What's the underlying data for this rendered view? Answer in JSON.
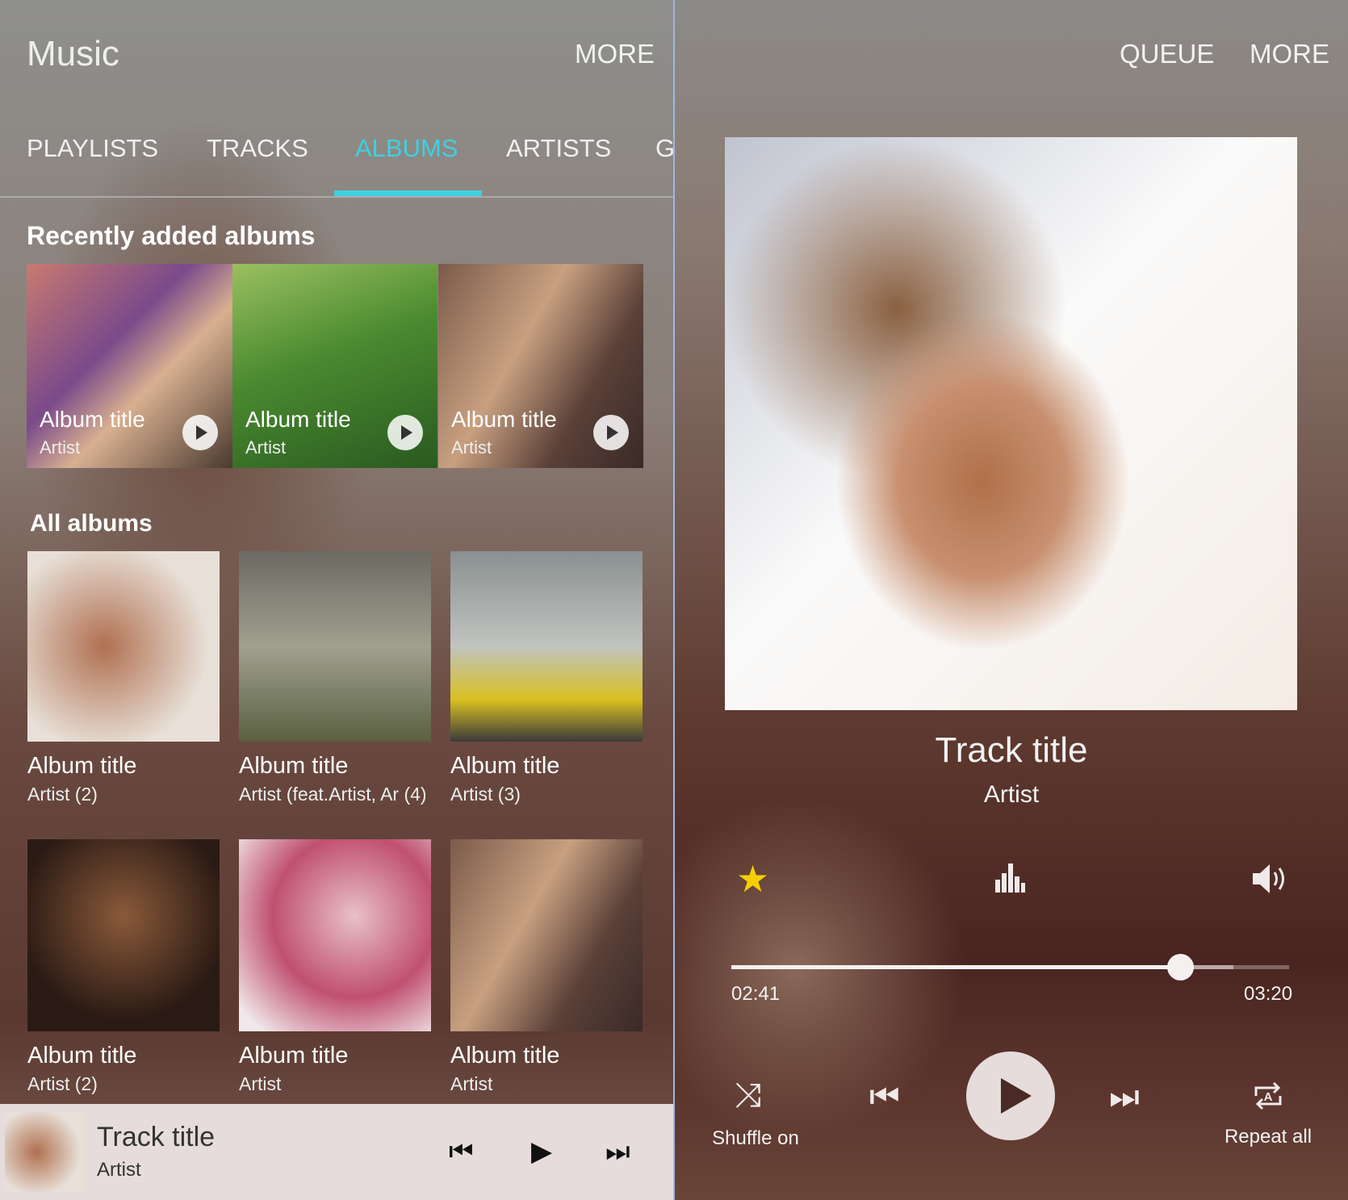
{
  "library": {
    "app_title": "Music",
    "more_label": "MORE",
    "tabs": [
      {
        "label": "PLAYLISTS"
      },
      {
        "label": "TRACKS"
      },
      {
        "label": "ALBUMS",
        "active": true
      },
      {
        "label": "ARTISTS"
      },
      {
        "label": "G"
      }
    ],
    "recent_heading": "Recently added albums",
    "recent": [
      {
        "title": "Album title",
        "artist": "Artist"
      },
      {
        "title": "Album title",
        "artist": "Artist"
      },
      {
        "title": "Album title",
        "artist": "Artist"
      }
    ],
    "all_heading": "All albums",
    "albums": [
      {
        "title": "Album title",
        "artist": "Artist (2)"
      },
      {
        "title": "Album title",
        "artist": "Artist (feat.Artist, Ar  (4)"
      },
      {
        "title": "Album title",
        "artist": "Artist (3)"
      },
      {
        "title": "Album title",
        "artist": "Artist (2)"
      },
      {
        "title": "Album title",
        "artist": "Artist"
      },
      {
        "title": "Album title",
        "artist": "Artist"
      }
    ],
    "mini_player": {
      "track": "Track title",
      "artist": "Artist"
    }
  },
  "player": {
    "queue_label": "QUEUE",
    "more_label": "MORE",
    "track": "Track title",
    "artist": "Artist",
    "favorite": true,
    "elapsed": "02:41",
    "duration": "03:20",
    "progress": 0.805,
    "buffered": 0.9,
    "shuffle_label": "Shuffle on",
    "repeat_label": "Repeat all"
  },
  "colors": {
    "accent": "#3fd0e0",
    "favorite": "#f5d000"
  }
}
